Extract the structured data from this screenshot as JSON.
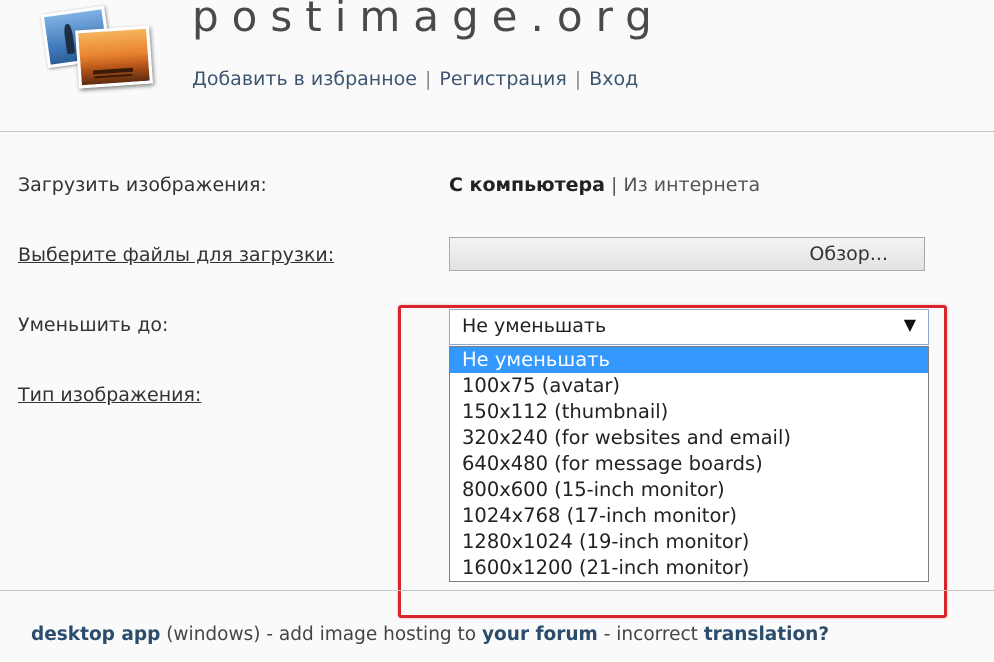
{
  "header": {
    "site_title": "postimage.org",
    "nav": [
      "Добавить в избранное",
      "Регистрация",
      "Вход"
    ]
  },
  "form": {
    "upload_label": "Загрузить изображения:",
    "source_computer": "С компьютера",
    "source_internet": "Из интернета",
    "choose_files_label": "Выберите файлы для загрузки:",
    "browse_button": "Обзор...",
    "resize_label": "Уменьшить до:",
    "resize_selected": "Не уменьшать",
    "resize_options": [
      "Не уменьшать",
      "100x75 (avatar)",
      "150x112 (thumbnail)",
      "320x240 (for websites and email)",
      "640x480 (for message boards)",
      "800x600 (15-inch monitor)",
      "1024x768 (17-inch monitor)",
      "1280x1024 (19-inch monitor)",
      "1600x1200 (21-inch monitor)"
    ],
    "image_type_label": "Тип изображения:"
  },
  "footer": {
    "desktop_app": "desktop app",
    "windows": "(windows)",
    "sep1": " - add image hosting to ",
    "your_forum": "your forum",
    "sep2": " - incorrect ",
    "translation": "translation?"
  },
  "colors": {
    "highlight": "#d7262b",
    "option_selected_bg": "#3399ff"
  },
  "icons": {
    "logo": "photos-logo-icon",
    "dropdown_arrow": "triangle-down-icon"
  }
}
